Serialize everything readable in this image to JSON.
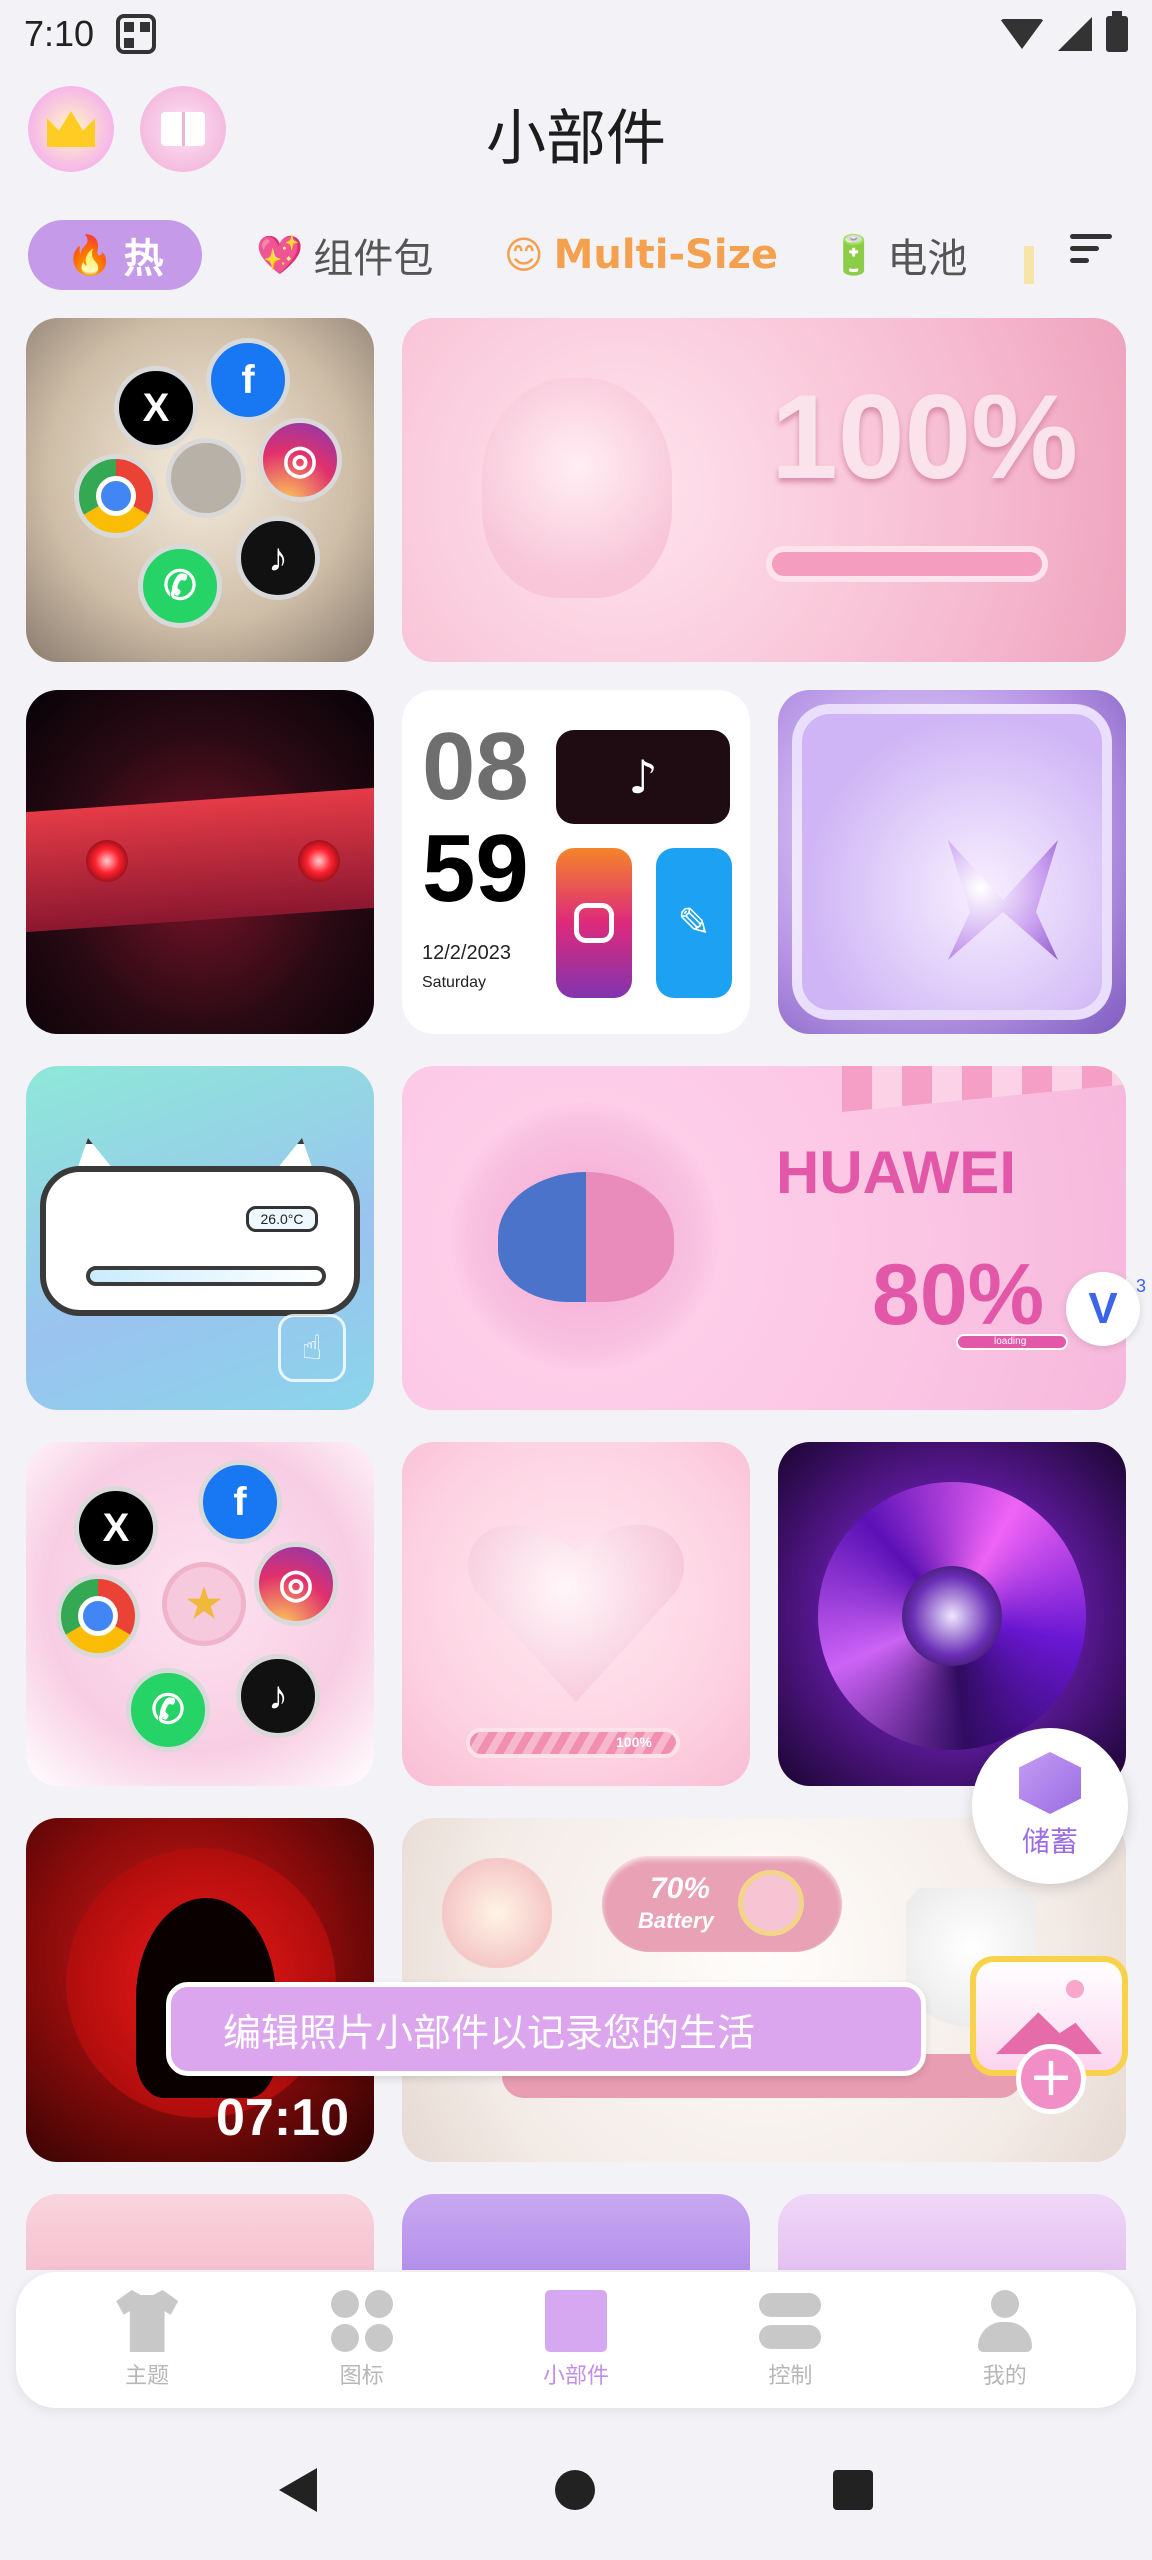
{
  "status_bar": {
    "time": "7:10"
  },
  "header": {
    "title": "小部件"
  },
  "tabs": [
    {
      "emoji": "🔥",
      "label": "热"
    },
    {
      "emoji": "💖",
      "label": "组件包"
    },
    {
      "emoji": "😊",
      "label": "Multi-Size"
    },
    {
      "emoji": "🔋",
      "label": "电池"
    }
  ],
  "widgets": {
    "pig_battery": {
      "percent": "100%"
    },
    "clock": {
      "hour": "08",
      "minute": "59",
      "date": "12/2/2023",
      "day": "Saturday"
    },
    "cat_widget": {
      "temperature": "26.0°C"
    },
    "huawei_battery": {
      "brand": "HUAWEI",
      "percent": "80%",
      "loading": "loading"
    },
    "heart_battery": {
      "percent": "100%"
    },
    "itachi_clock": {
      "time": "07:10"
    },
    "cake_battery": {
      "percent": "70%",
      "label": "Battery"
    }
  },
  "badge": {
    "count": "3",
    "letter": "V"
  },
  "toast": {
    "text": "编辑照片小部件以记录您的生活"
  },
  "storage_fab": {
    "label": "储蓄"
  },
  "bottom_nav": [
    {
      "label": "主题",
      "icon": "tshirt-icon"
    },
    {
      "label": "图标",
      "icon": "clover-icon"
    },
    {
      "label": "小部件",
      "icon": "widget-grid-icon",
      "active": true
    },
    {
      "label": "控制",
      "icon": "toggle-icon"
    },
    {
      "label": "我的",
      "icon": "user-icon"
    }
  ],
  "colors": {
    "accent": "#c59ae9",
    "accent_text": "#c18ee8",
    "background": "#f3f2f6"
  }
}
